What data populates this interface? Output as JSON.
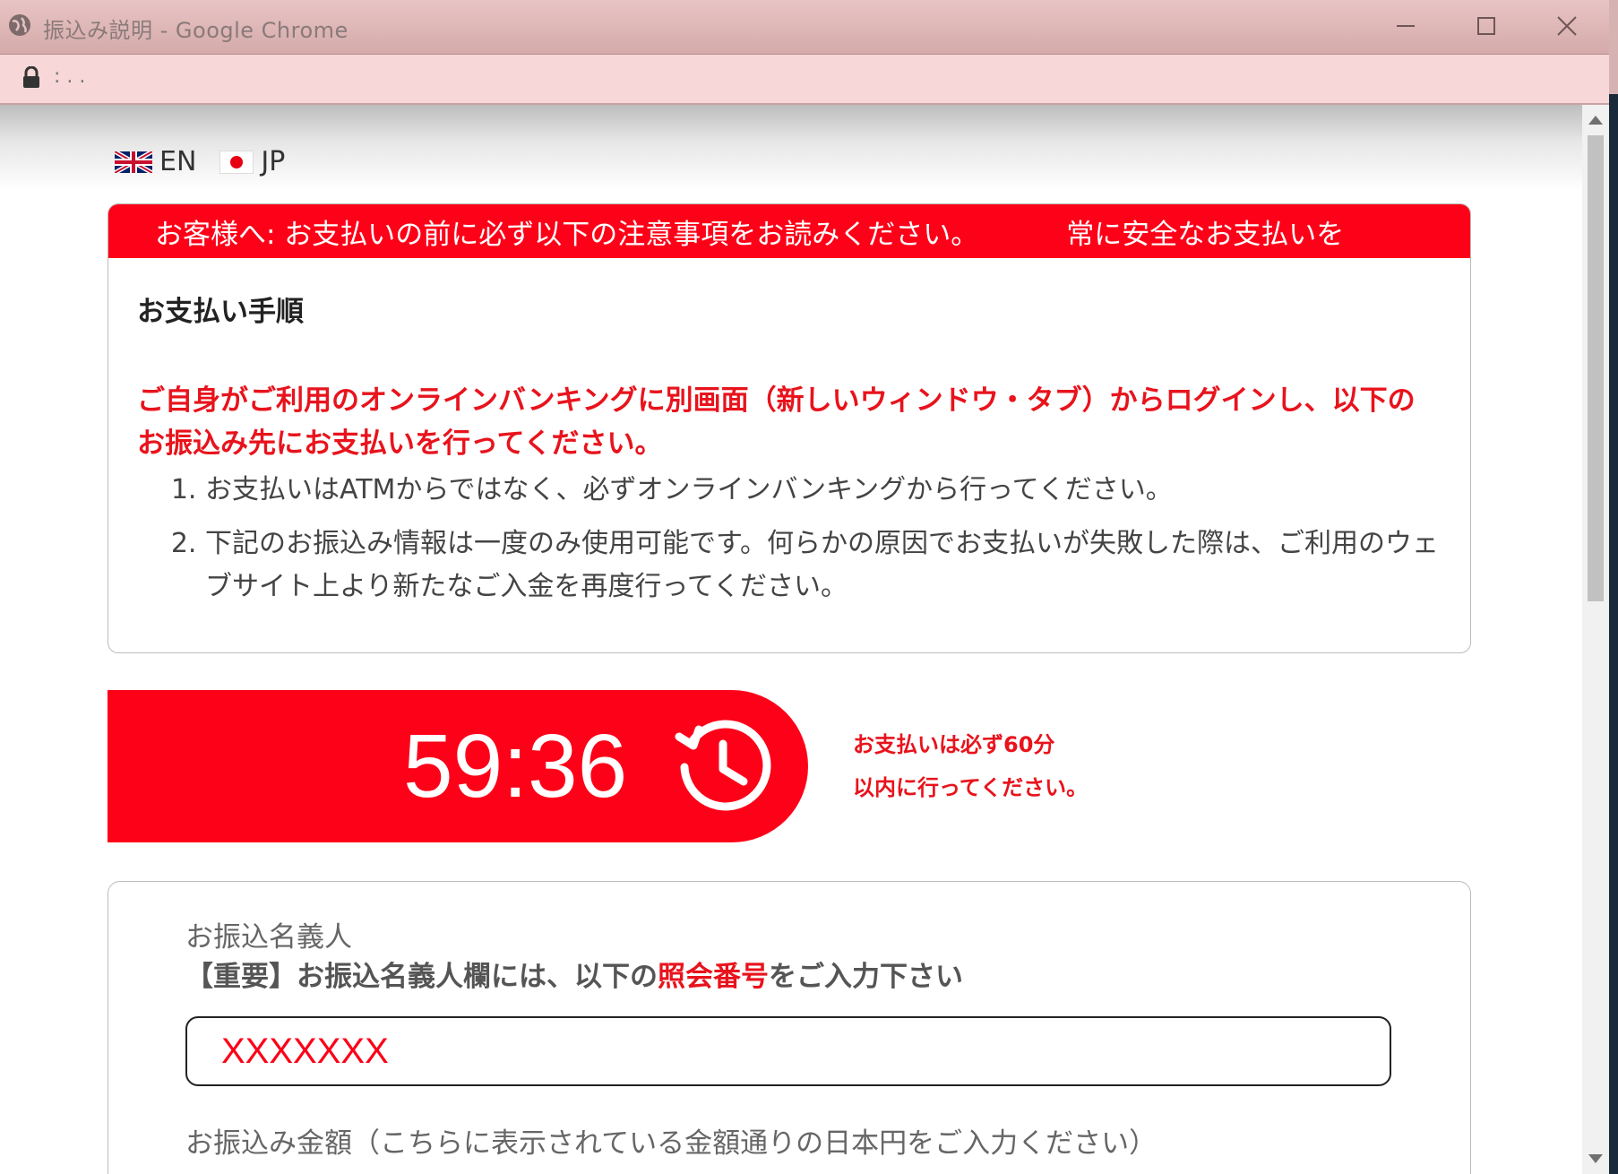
{
  "window": {
    "title": "振込み説明 - Google Chrome",
    "url": ": . ."
  },
  "page": {
    "lang_en": "EN",
    "lang_jp": "JP",
    "marquee_1": "お客様へ: お支払いの前に必ず以下の注意事項をお読みください。",
    "marquee_2": "常に安全なお支払いを",
    "steps_heading": "お支払い手順",
    "warning": "ご自身がご利用のオンラインバンキングに別画面（新しいウィンドウ・タブ）からログインし、以下のお振込み先にお支払いを行ってください。",
    "steps": [
      "お支払いはATMからではなく、必ずオンラインバンキングから行ってください。",
      "下記のお振込み情報は一度のみ使用可能です。何らかの原因でお支払いが失敗した際は、ご利用のウェブサイト上より新たなご入金を再度行ってください。"
    ],
    "timer": "59:36",
    "timer_note_1": "お支払いは必ず60分",
    "timer_note_2": "以内に行ってください。",
    "payer_label": "お振込名義人",
    "important_prefix": "【重要】お振込名義人欄には、以下の",
    "important_highlight": "照会番号",
    "important_suffix": "をご入力下さい",
    "reference_value": "XXXXXXX",
    "amount_label": "お振込み金額（こちらに表示されている金額通りの日本円をご入力ください）"
  },
  "colors": {
    "accent_red": "#fd0118",
    "text_red": "#e8131c"
  },
  "icons": [
    "globe-icon",
    "lock-icon",
    "minimize-icon",
    "maximize-icon",
    "close-icon",
    "uk-flag-icon",
    "japan-flag-icon",
    "clock-icon"
  ]
}
